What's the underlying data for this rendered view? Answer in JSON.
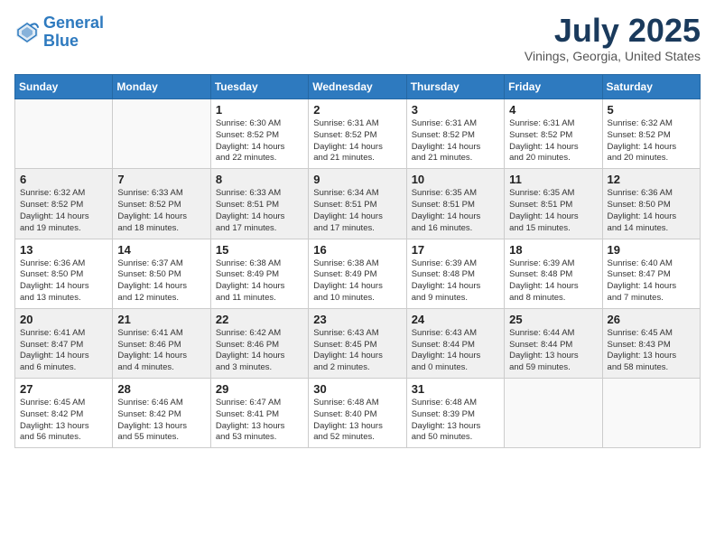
{
  "header": {
    "logo_line1": "General",
    "logo_line2": "Blue",
    "month_year": "July 2025",
    "location": "Vinings, Georgia, United States"
  },
  "days_of_week": [
    "Sunday",
    "Monday",
    "Tuesday",
    "Wednesday",
    "Thursday",
    "Friday",
    "Saturday"
  ],
  "weeks": [
    [
      {
        "day": "",
        "detail": ""
      },
      {
        "day": "",
        "detail": ""
      },
      {
        "day": "1",
        "detail": "Sunrise: 6:30 AM\nSunset: 8:52 PM\nDaylight: 14 hours\nand 22 minutes."
      },
      {
        "day": "2",
        "detail": "Sunrise: 6:31 AM\nSunset: 8:52 PM\nDaylight: 14 hours\nand 21 minutes."
      },
      {
        "day": "3",
        "detail": "Sunrise: 6:31 AM\nSunset: 8:52 PM\nDaylight: 14 hours\nand 21 minutes."
      },
      {
        "day": "4",
        "detail": "Sunrise: 6:31 AM\nSunset: 8:52 PM\nDaylight: 14 hours\nand 20 minutes."
      },
      {
        "day": "5",
        "detail": "Sunrise: 6:32 AM\nSunset: 8:52 PM\nDaylight: 14 hours\nand 20 minutes."
      }
    ],
    [
      {
        "day": "6",
        "detail": "Sunrise: 6:32 AM\nSunset: 8:52 PM\nDaylight: 14 hours\nand 19 minutes."
      },
      {
        "day": "7",
        "detail": "Sunrise: 6:33 AM\nSunset: 8:52 PM\nDaylight: 14 hours\nand 18 minutes."
      },
      {
        "day": "8",
        "detail": "Sunrise: 6:33 AM\nSunset: 8:51 PM\nDaylight: 14 hours\nand 17 minutes."
      },
      {
        "day": "9",
        "detail": "Sunrise: 6:34 AM\nSunset: 8:51 PM\nDaylight: 14 hours\nand 17 minutes."
      },
      {
        "day": "10",
        "detail": "Sunrise: 6:35 AM\nSunset: 8:51 PM\nDaylight: 14 hours\nand 16 minutes."
      },
      {
        "day": "11",
        "detail": "Sunrise: 6:35 AM\nSunset: 8:51 PM\nDaylight: 14 hours\nand 15 minutes."
      },
      {
        "day": "12",
        "detail": "Sunrise: 6:36 AM\nSunset: 8:50 PM\nDaylight: 14 hours\nand 14 minutes."
      }
    ],
    [
      {
        "day": "13",
        "detail": "Sunrise: 6:36 AM\nSunset: 8:50 PM\nDaylight: 14 hours\nand 13 minutes."
      },
      {
        "day": "14",
        "detail": "Sunrise: 6:37 AM\nSunset: 8:50 PM\nDaylight: 14 hours\nand 12 minutes."
      },
      {
        "day": "15",
        "detail": "Sunrise: 6:38 AM\nSunset: 8:49 PM\nDaylight: 14 hours\nand 11 minutes."
      },
      {
        "day": "16",
        "detail": "Sunrise: 6:38 AM\nSunset: 8:49 PM\nDaylight: 14 hours\nand 10 minutes."
      },
      {
        "day": "17",
        "detail": "Sunrise: 6:39 AM\nSunset: 8:48 PM\nDaylight: 14 hours\nand 9 minutes."
      },
      {
        "day": "18",
        "detail": "Sunrise: 6:39 AM\nSunset: 8:48 PM\nDaylight: 14 hours\nand 8 minutes."
      },
      {
        "day": "19",
        "detail": "Sunrise: 6:40 AM\nSunset: 8:47 PM\nDaylight: 14 hours\nand 7 minutes."
      }
    ],
    [
      {
        "day": "20",
        "detail": "Sunrise: 6:41 AM\nSunset: 8:47 PM\nDaylight: 14 hours\nand 6 minutes."
      },
      {
        "day": "21",
        "detail": "Sunrise: 6:41 AM\nSunset: 8:46 PM\nDaylight: 14 hours\nand 4 minutes."
      },
      {
        "day": "22",
        "detail": "Sunrise: 6:42 AM\nSunset: 8:46 PM\nDaylight: 14 hours\nand 3 minutes."
      },
      {
        "day": "23",
        "detail": "Sunrise: 6:43 AM\nSunset: 8:45 PM\nDaylight: 14 hours\nand 2 minutes."
      },
      {
        "day": "24",
        "detail": "Sunrise: 6:43 AM\nSunset: 8:44 PM\nDaylight: 14 hours\nand 0 minutes."
      },
      {
        "day": "25",
        "detail": "Sunrise: 6:44 AM\nSunset: 8:44 PM\nDaylight: 13 hours\nand 59 minutes."
      },
      {
        "day": "26",
        "detail": "Sunrise: 6:45 AM\nSunset: 8:43 PM\nDaylight: 13 hours\nand 58 minutes."
      }
    ],
    [
      {
        "day": "27",
        "detail": "Sunrise: 6:45 AM\nSunset: 8:42 PM\nDaylight: 13 hours\nand 56 minutes."
      },
      {
        "day": "28",
        "detail": "Sunrise: 6:46 AM\nSunset: 8:42 PM\nDaylight: 13 hours\nand 55 minutes."
      },
      {
        "day": "29",
        "detail": "Sunrise: 6:47 AM\nSunset: 8:41 PM\nDaylight: 13 hours\nand 53 minutes."
      },
      {
        "day": "30",
        "detail": "Sunrise: 6:48 AM\nSunset: 8:40 PM\nDaylight: 13 hours\nand 52 minutes."
      },
      {
        "day": "31",
        "detail": "Sunrise: 6:48 AM\nSunset: 8:39 PM\nDaylight: 13 hours\nand 50 minutes."
      },
      {
        "day": "",
        "detail": ""
      },
      {
        "day": "",
        "detail": ""
      }
    ]
  ]
}
